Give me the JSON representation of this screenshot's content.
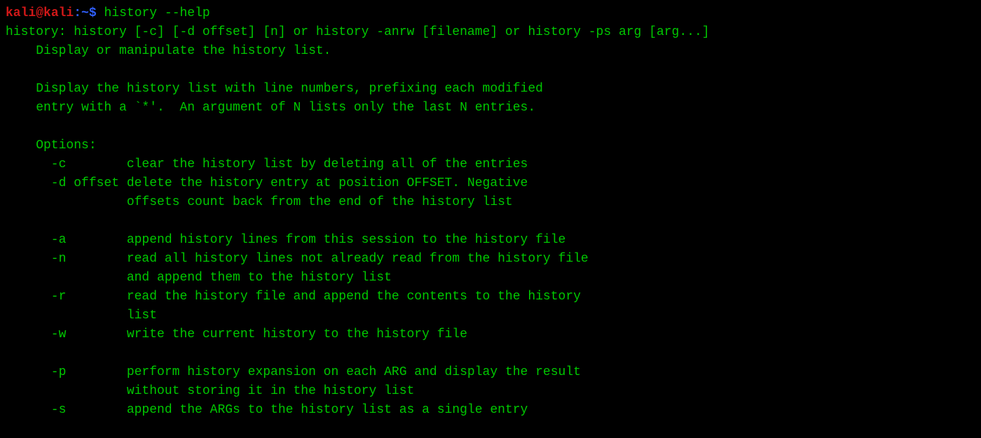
{
  "prompt": {
    "user": "kali",
    "at": "@",
    "host": "kali",
    "colon_path": ":~",
    "dollar": "$"
  },
  "command": "history --help",
  "output": {
    "line1": "history: history [-c] [-d offset] [n] or history -anrw [filename] or history -ps arg [arg...]",
    "line2": "    Display or manipulate the history list.",
    "line3": "    Display the history list with line numbers, prefixing each modified",
    "line4": "    entry with a `*'.  An argument of N lists only the last N entries.",
    "line5": "    Options:",
    "line6": "      -c        clear the history list by deleting all of the entries",
    "line7": "      -d offset delete the history entry at position OFFSET. Negative",
    "line8": "                offsets count back from the end of the history list",
    "line9": "      -a        append history lines from this session to the history file",
    "line10": "      -n        read all history lines not already read from the history file",
    "line11": "                and append them to the history list",
    "line12": "      -r        read the history file and append the contents to the history",
    "line13": "                list",
    "line14": "      -w        write the current history to the history file",
    "line15": "      -p        perform history expansion on each ARG and display the result",
    "line16": "                without storing it in the history list",
    "line17": "      -s        append the ARGs to the history list as a single entry"
  }
}
